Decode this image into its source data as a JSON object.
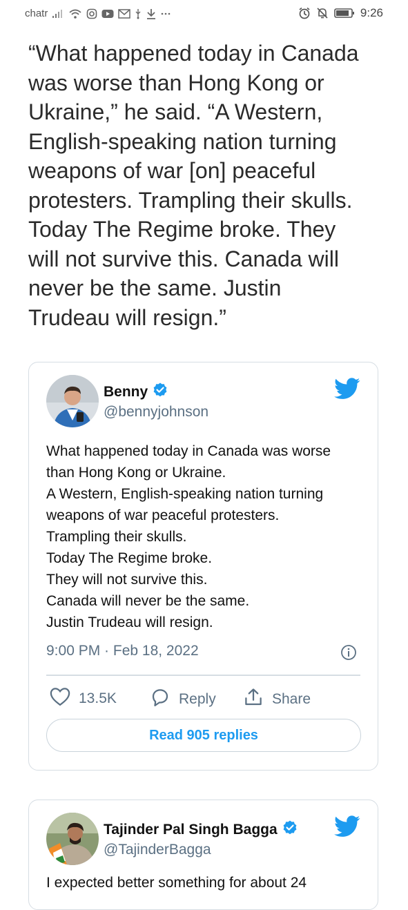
{
  "status_bar": {
    "carrier": "chatr",
    "time": "9:26"
  },
  "article": {
    "lines": [
      "“What happened today in Canada",
      "was worse than Hong Kong or",
      "Ukraine,” he said. “A Western,",
      "English-speaking nation turning",
      "weapons of war [on] peaceful",
      "protesters. Trampling their skulls.",
      "Today The Regime broke. They",
      "will not survive this. Canada will",
      "never be the same. Justin",
      "Trudeau will resign.”"
    ]
  },
  "tweet1": {
    "name": "Benny",
    "handle": "@bennyjohnson",
    "body_lines": [
      "What happened today in Canada was worse",
      "than Hong Kong or Ukraine.",
      "A Western, English-speaking nation turning",
      "weapons of war peaceful protesters.",
      "Trampling their skulls.",
      "Today The Regime broke.",
      "They will not survive this.",
      "Canada will never be the same.",
      "Justin Trudeau will resign."
    ],
    "timestamp": "9:00 PM · Feb 18, 2022",
    "like_count": "13.5K",
    "reply_label": "Reply",
    "share_label": "Share",
    "read_replies_label": "Read 905 replies"
  },
  "tweet2": {
    "name": "Tajinder Pal Singh Bagga",
    "handle": "@TajinderBagga",
    "body_partial": "I expected better something for about 24"
  },
  "colors": {
    "twitter_blue": "#1d9bf0",
    "verified_blue": "#1d9bf0",
    "secondary_text": "#5b7083",
    "border": "#d6dde3"
  }
}
